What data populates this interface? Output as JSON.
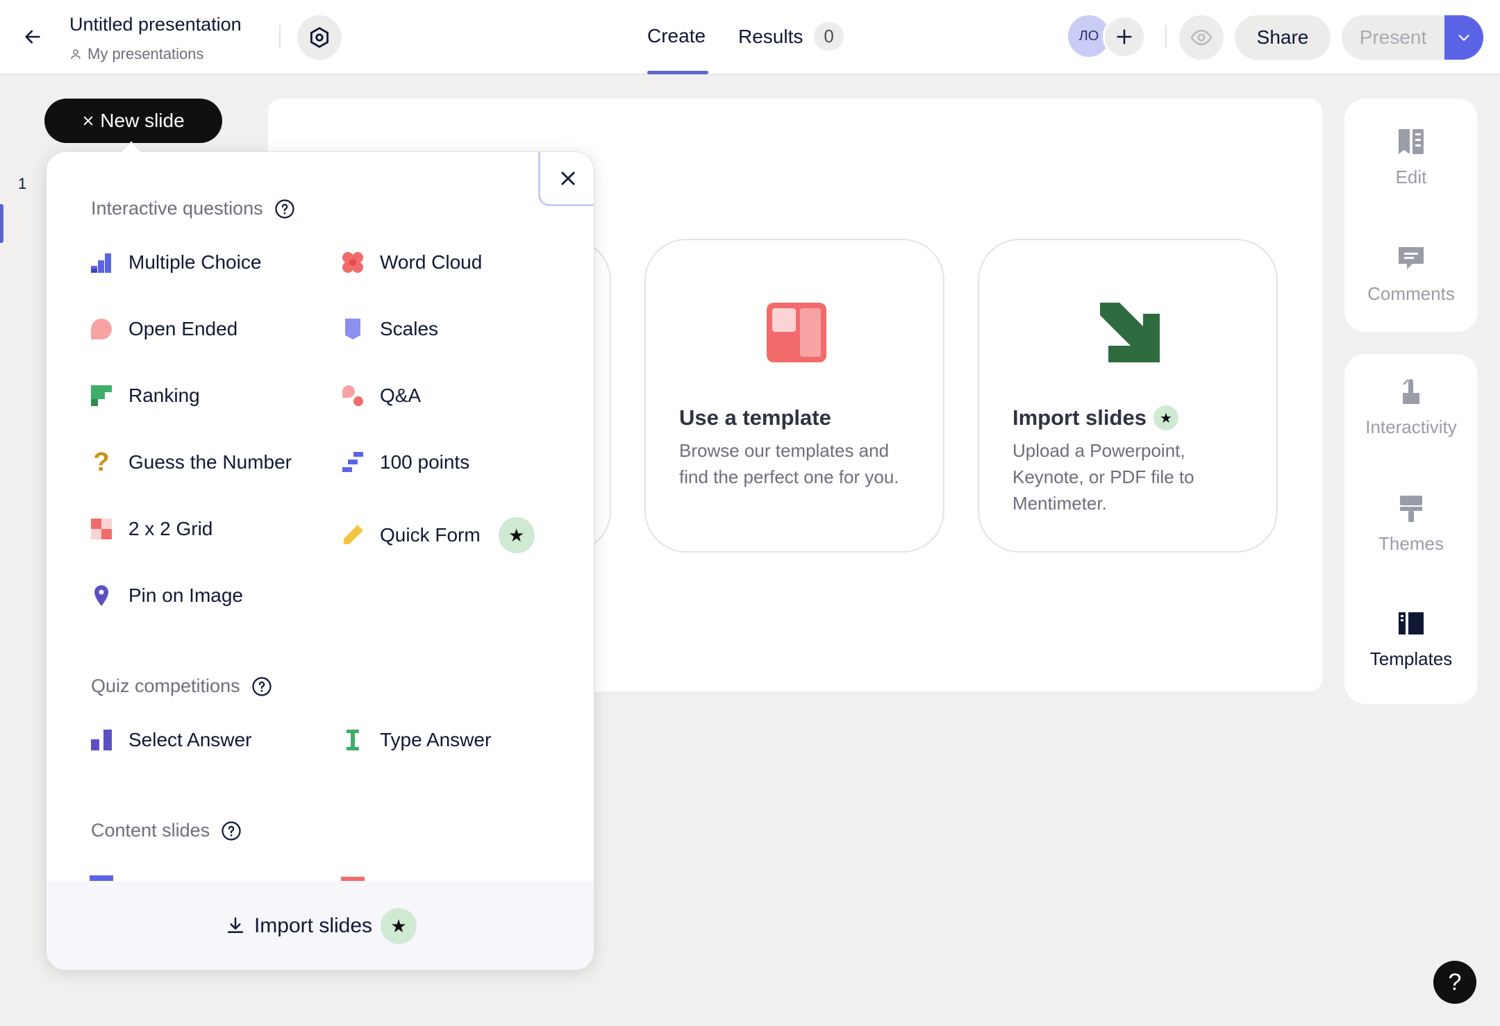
{
  "header": {
    "title": "Untitled presentation",
    "folder": "My presentations",
    "tabs": {
      "create": "Create",
      "results": "Results",
      "results_count": "0"
    },
    "avatar_initials": "ЛО",
    "share_label": "Share",
    "present_label": "Present"
  },
  "left": {
    "new_slide_label": "New slide",
    "slide_number": "1"
  },
  "canvas": {
    "cards": {
      "template": {
        "title": "Use a template",
        "desc": "Browse our templates and find the perfect one for you."
      },
      "import": {
        "title": "Import slides",
        "desc": "Upload a Powerpoint, Keynote, or PDF file to Mentimeter."
      }
    }
  },
  "right_panel": {
    "edit": "Edit",
    "comments": "Comments",
    "interactivity": "Interactivity",
    "themes": "Themes",
    "templates": "Templates"
  },
  "popup": {
    "sections": {
      "interactive": "Interactive questions",
      "quiz": "Quiz competitions",
      "content": "Content slides"
    },
    "interactive": {
      "multiple_choice": "Multiple Choice",
      "word_cloud": "Word Cloud",
      "open_ended": "Open Ended",
      "scales": "Scales",
      "ranking": "Ranking",
      "qa": "Q&A",
      "guess_number": "Guess the Number",
      "points_100": "100 points",
      "grid_2x2": "2 x 2 Grid",
      "quick_form": "Quick Form",
      "pin_on_image": "Pin on Image"
    },
    "quiz": {
      "select_answer": "Select Answer",
      "type_answer": "Type Answer"
    },
    "footer_label": "Import slides"
  },
  "icons": {
    "back": "arrow-left-icon",
    "settings": "hexagon-settings-icon",
    "preview": "eye-icon",
    "help": "question-icon"
  },
  "colors": {
    "accent": "#5b64e6",
    "present_dropdown": "#5b64e6",
    "star_badge": "#cfe9d3",
    "template_icon": "#f26b6b",
    "import_icon": "#2e6b3e"
  }
}
